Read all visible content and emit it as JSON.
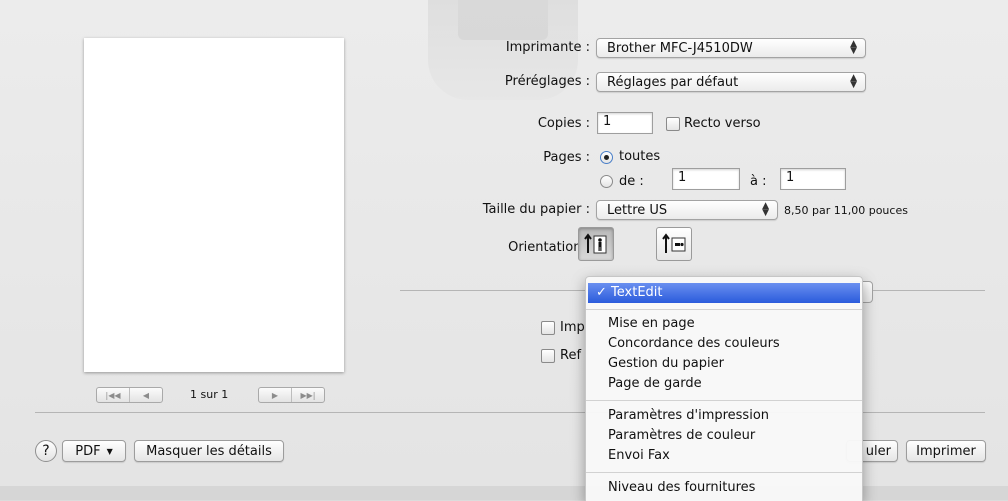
{
  "printer": {
    "label": "Imprimante :",
    "value": "Brother MFC-J4510DW"
  },
  "presets": {
    "label": "Préréglages :",
    "value": "Réglages par défaut"
  },
  "copies": {
    "label": "Copies :",
    "value": "1",
    "duplex_label": "Recto verso",
    "duplex_checked": false
  },
  "pages": {
    "label": "Pages :",
    "all_label": "toutes",
    "from_label": "de :",
    "from_value": "1",
    "to_label": "à :",
    "to_value": "1",
    "selected": "toutes"
  },
  "paper": {
    "label": "Taille du papier :",
    "value": "Lettre US",
    "size_text": "8,50 par 11,00 pouces"
  },
  "orientation": {
    "label": "Orientation :",
    "selected": "portrait"
  },
  "hidden_options": {
    "option1_partial": "Imp",
    "option2_partial": "Ref"
  },
  "preview": {
    "page_count": "1 sur 1"
  },
  "bottom": {
    "pdf_label": "PDF",
    "hide_details_label": "Masquer les détails",
    "cancel_partial": "uler",
    "print_label": "Imprimer"
  },
  "menu": {
    "selected": "TextEdit",
    "groups": [
      [
        "TextEdit"
      ],
      [
        "Mise en page",
        "Concordance des couleurs",
        "Gestion du papier",
        "Page de garde"
      ],
      [
        "Paramètres d'impression",
        "Paramètres de couleur",
        "Envoi Fax"
      ],
      [
        "Niveau des fournitures"
      ]
    ]
  },
  "colors": {
    "highlight": "#3b6ee6",
    "window": "#ececec"
  }
}
